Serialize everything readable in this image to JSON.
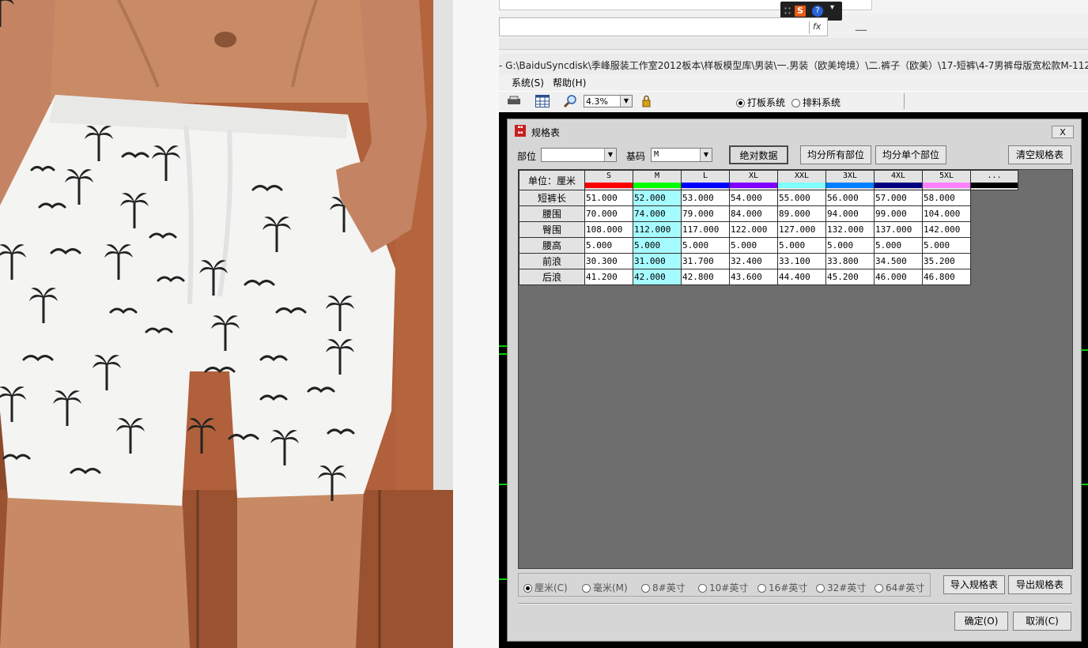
{
  "photo": {
    "colors": {
      "skin": "#c98b66",
      "shorts": "#f4f4f2",
      "print": "#222222",
      "wood": "#b0603a",
      "stripe": "#d9d9d9"
    },
    "icons": [
      "palm-tree-icon",
      "seagull-icon"
    ]
  },
  "app": {
    "title": "- G:\\BaiduSyncdisk\\季峰服装工作室2012板本\\样板模型库\\男装\\一.男装（欧美垮境）\\二.裤子（欧美）\\17-短裤\\4-7男裤母版宽松款M-112",
    "fx_label": "fx",
    "menu": {
      "system": "系统(S)",
      "help": "帮助(H)"
    },
    "toolbar": {
      "zoom": "4.3%",
      "mode_pattern": "打板系统",
      "mode_layout": "排料系统",
      "selected_mode": "打板系统"
    }
  },
  "dialog": {
    "title": "规格表",
    "close_label": "X",
    "part_label": "部位",
    "part_value": "",
    "base_label": "基码",
    "base_value": "M",
    "btn_absolute": "绝对数据",
    "btn_distribute_all": "均分所有部位",
    "btn_distribute_one": "均分单个部位",
    "btn_clear": "清空规格表",
    "unit_header": "单位：厘米",
    "sizes": [
      {
        "label": "S",
        "color": "#ff0000"
      },
      {
        "label": "M",
        "color": "#00ff00"
      },
      {
        "label": "L",
        "color": "#0000ff"
      },
      {
        "label": "XL",
        "color": "#8000ff"
      },
      {
        "label": "XXL",
        "color": "#80ffff"
      },
      {
        "label": "3XL",
        "color": "#0080ff"
      },
      {
        "label": "4XL",
        "color": "#000080"
      },
      {
        "label": "5XL",
        "color": "#ff80ff"
      },
      {
        "label": "...",
        "color": "#000000"
      }
    ],
    "base_index": 1,
    "rows": [
      {
        "name": "短裤长",
        "values": [
          "51.000",
          "52.000",
          "53.000",
          "54.000",
          "55.000",
          "56.000",
          "57.000",
          "58.000"
        ]
      },
      {
        "name": "腰围",
        "values": [
          "70.000",
          "74.000",
          "79.000",
          "84.000",
          "89.000",
          "94.000",
          "99.000",
          "104.000"
        ]
      },
      {
        "name": "臀围",
        "values": [
          "108.000",
          "112.000",
          "117.000",
          "122.000",
          "127.000",
          "132.000",
          "137.000",
          "142.000"
        ]
      },
      {
        "name": "腰高",
        "values": [
          "5.000",
          "5.000",
          "5.000",
          "5.000",
          "5.000",
          "5.000",
          "5.000",
          "5.000"
        ]
      },
      {
        "name": "前浪",
        "values": [
          "30.300",
          "31.000",
          "31.700",
          "32.400",
          "33.100",
          "33.800",
          "34.500",
          "35.200"
        ]
      },
      {
        "name": "后浪",
        "values": [
          "41.200",
          "42.000",
          "42.800",
          "43.600",
          "44.400",
          "45.200",
          "46.000",
          "46.800"
        ]
      }
    ],
    "units": [
      "厘米(C)",
      "毫米(M)",
      "8#英寸",
      "10#英寸",
      "16#英寸",
      "32#英寸",
      "64#英寸"
    ],
    "selected_unit": "厘米(C)",
    "btn_import": "导入规格表",
    "btn_export": "导出规格表",
    "btn_ok": "确定(O)",
    "btn_cancel": "取消(C)"
  }
}
